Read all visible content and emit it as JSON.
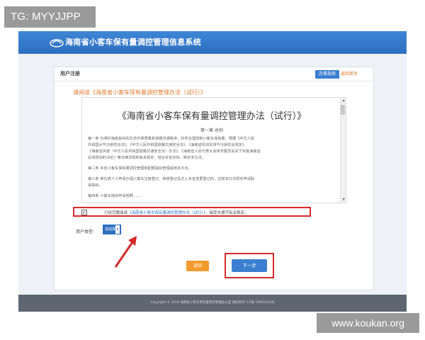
{
  "watermarks": {
    "top_tag": "TG: MYYJJPP",
    "bottom_tag": "www.koukan.org"
  },
  "header": {
    "title": "海南省小客车保有量调控管理信息系统",
    "logo_icon": "car-logo-icon"
  },
  "panel": {
    "title": "用户注册",
    "guide_button": "办事指南",
    "return_link": "返回首页"
  },
  "notice": "请阅读《海南省小客车保有量调控管理办法（试行）》",
  "document": {
    "title": "《海南省小客车保有量调控管理办法（试行）》",
    "chapter": "第一章 总则",
    "paragraphs": [
      "第一条 为维护海南良好的生态环境质量和道路交通秩序，科学合理控制小客车保有量，根据《中华人民",
      "共和国大气污染防治法》、《中华人民共和国道路交通安全法》、《海南省机动车排气污染防治规定》、",
      "《海南省实施〈中华人民共和国道路交通安全法〉办法》、《海南省人民代表大会常务委员会关于实施海南省",
      "总体规划的决定》等法律法规和有关规定，结合本省实际，制定本办法。",
      "第二条 本省小客车保有量调控管理和配额指标管理适用本办法。",
      "第三条 单位或个人申请办理小客车注册登记、转移登记及迁入本省变更登记的，应按本办法规定申请取",
      "得指标。",
      "第四条 小客车指标申请按照……"
    ]
  },
  "agreement": {
    "checked_mark": "✓",
    "text_prefix": "已经完整阅读",
    "link_text": "《海南省小客车保有量调控管理办法（试行）》",
    "text_suffix": "，接受并遵守有关规定。"
  },
  "user_type": {
    "label": "用户类型:",
    "selected": "请选择",
    "chevron": "▾"
  },
  "buttons": {
    "back": "返回",
    "next": "下一步"
  },
  "footer": {
    "text": "Copyright © 2018  海南省小客车保有量调控管理办公室  版权所有  ICP备 18002424号"
  },
  "colors": {
    "header_blue": "#2d6fbf",
    "accent_orange": "#e0792b",
    "highlight_red": "#d62a2a",
    "footer_gray": "#5e6672"
  }
}
